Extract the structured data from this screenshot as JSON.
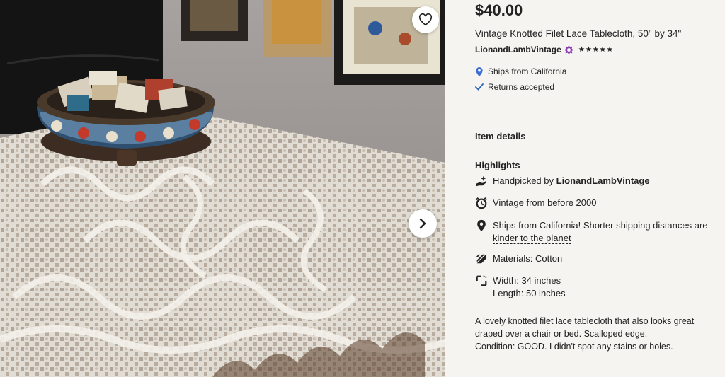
{
  "listing": {
    "price": "$40.00",
    "title": "Vintage Knotted Filet Lace Tablecloth, 50\" by 34\"",
    "shop_name": "LionandLambVintage",
    "rating_stars": "★★★★★",
    "ships_from": "Ships from California",
    "returns": "Returns accepted"
  },
  "item_details": {
    "heading": "Item details",
    "highlights_heading": "Highlights",
    "handpicked_prefix": "Handpicked by ",
    "handpicked_shop": "LionandLambVintage",
    "vintage": "Vintage from before 2000",
    "ships_note": "Ships from California! Shorter shipping distances are ",
    "ships_link": "kinder to the planet",
    "materials": "Materials: Cotton",
    "width": "Width: 34 inches",
    "length": "Length: 50 inches"
  },
  "description": {
    "line1": "A lovely knotted filet lace tablecloth that also looks great draped over a chair or bed. Scalloped edge.",
    "line2": "Condition: GOOD. I didn't spot any stains or holes."
  },
  "icons": {
    "favorite": "heart-icon",
    "next": "chevron-right-icon",
    "star_seller": "star-seller-badge-icon",
    "location": "location-pin-icon",
    "returns": "checkmark-icon",
    "handpicked": "hand-sparkle-icon",
    "vintage": "alarm-clock-icon",
    "ships": "map-pin-icon",
    "materials": "fabric-icon",
    "dimensions": "dimensions-icon"
  },
  "colors": {
    "panel_bg": "#f5f4f1",
    "text": "#222222",
    "star_seller": "#8d3bb2",
    "location_pin": "#3b6fd6",
    "check": "#2f66b8"
  }
}
